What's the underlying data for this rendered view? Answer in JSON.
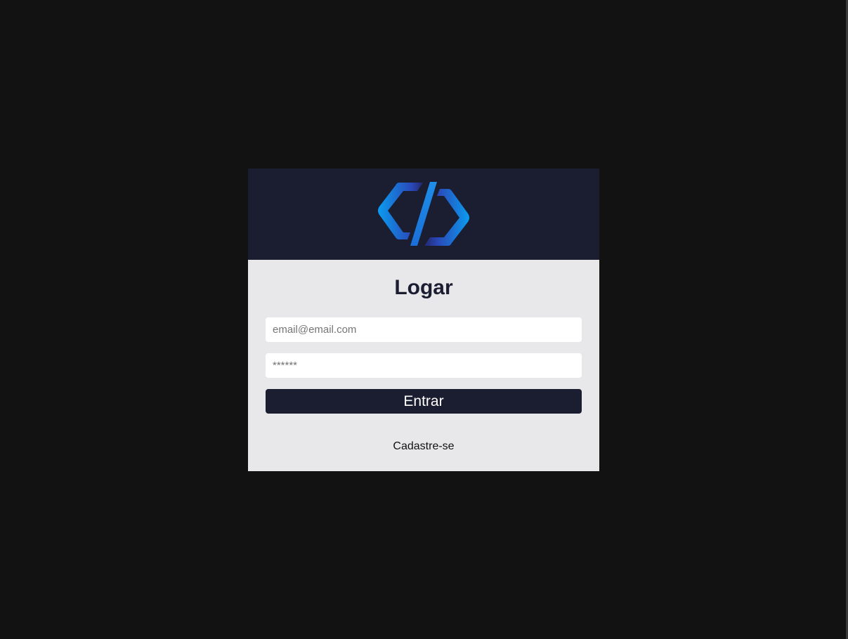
{
  "login": {
    "title": "Logar",
    "email_placeholder": "email@email.com",
    "password_placeholder": "******",
    "submit_label": "Entrar",
    "signup_label": "Cadastre-se"
  },
  "logo": {
    "icon": "code-brackets-logo"
  },
  "colors": {
    "background": "#121212",
    "header": "#1b1d31",
    "card": "#e8e8ea",
    "button": "#1b1d31",
    "logo_light": "#0a9ff0",
    "logo_dark": "#2b3a9a"
  }
}
